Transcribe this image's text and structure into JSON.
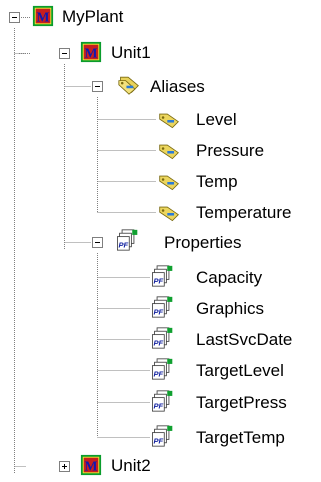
{
  "tree": {
    "root": {
      "label": "MyPlant",
      "expanded": true,
      "icon": "model-icon"
    },
    "unit1": {
      "label": "Unit1",
      "expanded": true,
      "icon": "model-icon"
    },
    "aliases": {
      "label": "Aliases",
      "expanded": true,
      "icon": "alias-tag-folder-icon",
      "items": [
        {
          "label": "Level",
          "icon": "alias-tag-icon"
        },
        {
          "label": "Pressure",
          "icon": "alias-tag-icon"
        },
        {
          "label": "Temp",
          "icon": "alias-tag-icon"
        },
        {
          "label": "Temperature",
          "icon": "alias-tag-icon"
        }
      ]
    },
    "properties": {
      "label": "Properties",
      "expanded": true,
      "icon": "property-folder-icon",
      "items": [
        {
          "label": "Capacity",
          "icon": "property-icon"
        },
        {
          "label": "Graphics",
          "icon": "property-icon"
        },
        {
          "label": "LastSvcDate",
          "icon": "property-icon"
        },
        {
          "label": "TargetLevel",
          "icon": "property-icon"
        },
        {
          "label": "TargetPress",
          "icon": "property-icon"
        },
        {
          "label": "TargetTemp",
          "icon": "property-icon"
        }
      ]
    },
    "unit2": {
      "label": "Unit2",
      "expanded": false,
      "icon": "model-icon"
    }
  }
}
